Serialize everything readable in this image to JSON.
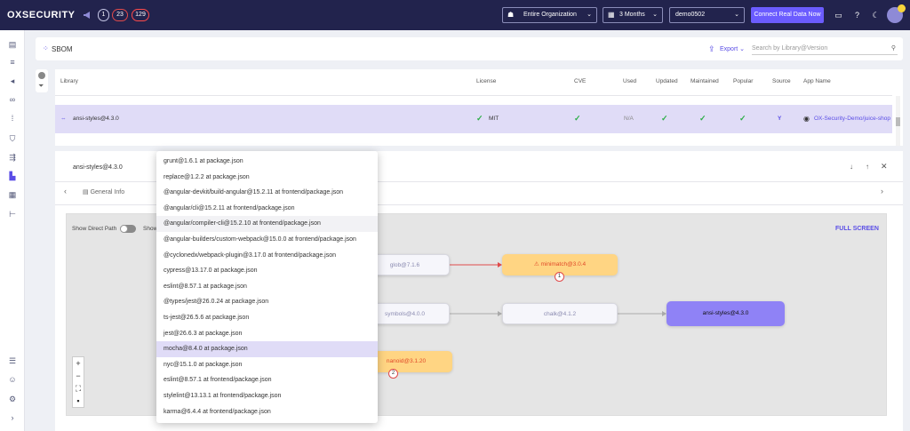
{
  "header": {
    "logo": "OXSECURITY",
    "badges": [
      "1",
      "23",
      "129"
    ],
    "org_dropdown": "Entire Organization",
    "period_dropdown": "3 Months",
    "workspace_dropdown": "demo0502",
    "connect_button": "Connect Real Data Now"
  },
  "sbom": {
    "title": "SBOM",
    "export_label": "Export",
    "search_placeholder": "Search by Library@Version"
  },
  "table": {
    "headers": [
      "Library",
      "License",
      "CVE",
      "Used",
      "Updated",
      "Maintained",
      "Popular",
      "Source",
      "App Name"
    ],
    "selected_row": {
      "library": "ansi-styles@4.3.0",
      "license": "MIT",
      "used": "N/A",
      "source": "Y",
      "app_name": "OX-Security-Demo/juice-shop"
    }
  },
  "detail": {
    "title": "ansi-styles@4.3.0",
    "tab_general": "General Info",
    "show_direct_path": "Show Direct Path",
    "show_trunc": "Show",
    "full_screen": "FULL SCREEN",
    "nodes": {
      "glob": "glob@7.1.6",
      "minimatch": "minimatch@3.0.4",
      "minimatch_badge": "1",
      "symbols": "symbols@4.0.0",
      "chalk": "chalk@4.1.2",
      "ansi": "ansi-styles@4.3.0",
      "nanoid": "nanoid@3.1.20",
      "nanoid_badge": "2"
    }
  },
  "dependency_menu": [
    "grunt@1.6.1 at package.json",
    "replace@1.2.2 at package.json",
    "@angular-devkit/build-angular@15.2.11 at frontend/package.json",
    "@angular/cli@15.2.11 at frontend/package.json",
    "@angular/compiler-cli@15.2.10 at frontend/package.json",
    "@angular-builders/custom-webpack@15.0.0 at frontend/package.json",
    "@cyclonedx/webpack-plugin@3.17.0 at frontend/package.json",
    "cypress@13.17.0 at package.json",
    "eslint@8.57.1 at package.json",
    "@types/jest@26.0.24 at package.json",
    "ts-jest@26.5.6 at package.json",
    "jest@26.6.3 at package.json",
    "mocha@8.4.0 at package.json",
    "nyc@15.1.0 at package.json",
    "eslint@8.57.1 at frontend/package.json",
    "stylelint@13.13.1 at frontend/package.json",
    "karma@6.4.4 at frontend/package.json"
  ],
  "colors": {
    "brand": "#22234d",
    "accent": "#6b5cff",
    "check": "#2cae47"
  }
}
